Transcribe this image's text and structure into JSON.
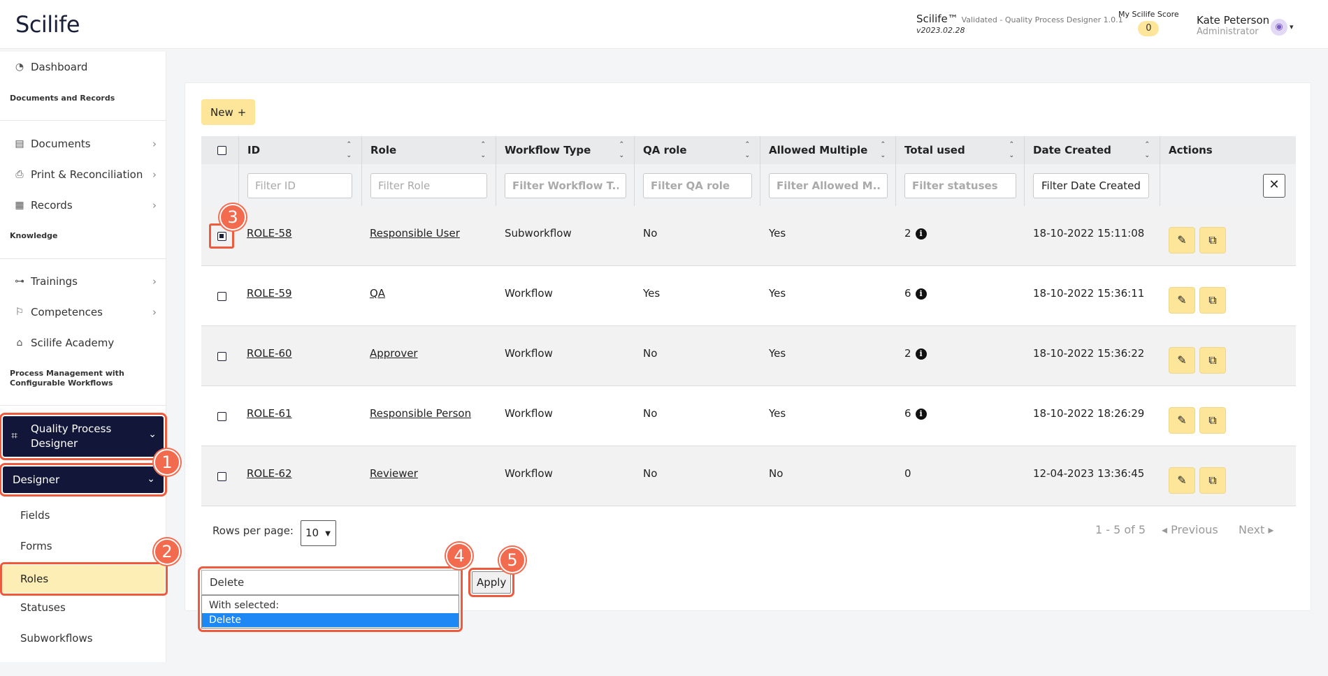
{
  "header": {
    "logo": "Scilife",
    "app_name": "Scilife™",
    "app_desc": "Validated - Quality Process Designer 1.0.1",
    "version": "v2023.02.28",
    "score_label": "My Scilife Score",
    "score_value": "0",
    "user_name": "Kate Peterson",
    "user_role": "Administrator"
  },
  "sidebar": {
    "dashboard": "Dashboard",
    "section_docs": "Documents and Records",
    "documents": "Documents",
    "print": "Print & Reconciliation",
    "records": "Records",
    "section_knowledge": "Knowledge",
    "trainings": "Trainings",
    "competences": "Competences",
    "academy": "Scilife Academy",
    "section_process": "Process Management with Configurable Workflows",
    "qpd": "Quality Process Designer",
    "designer": "Designer",
    "fields": "Fields",
    "forms": "Forms",
    "roles": "Roles",
    "statuses": "Statuses",
    "subworkflows": "Subworkflows"
  },
  "toolbar": {
    "new_label": "New"
  },
  "table": {
    "columns": [
      "ID",
      "Role",
      "Workflow Type",
      "QA role",
      "Allowed Multiple",
      "Total used",
      "Date Created",
      "Actions"
    ],
    "filters": {
      "id": "Filter ID",
      "role": "Filter Role",
      "workflow_type": "Filter Workflow T...",
      "qa_role": "Filter QA role",
      "allowed_multiple": "Filter Allowed M...",
      "total_used": "Filter statuses",
      "date_created": "Filter Date Created"
    },
    "rows": [
      {
        "id": "ROLE-58",
        "role": "Responsible User",
        "type": "Subworkflow",
        "qa": "No",
        "multiple": "Yes",
        "used": "2",
        "date": "18-10-2022 15:11:08",
        "checked": true
      },
      {
        "id": "ROLE-59",
        "role": "QA",
        "type": "Workflow",
        "qa": "Yes",
        "multiple": "Yes",
        "used": "6",
        "date": "18-10-2022 15:36:11",
        "checked": false
      },
      {
        "id": "ROLE-60",
        "role": "Approver",
        "type": "Workflow",
        "qa": "No",
        "multiple": "Yes",
        "used": "2",
        "date": "18-10-2022 15:36:22",
        "checked": false
      },
      {
        "id": "ROLE-61",
        "role": "Responsible Person",
        "type": "Workflow",
        "qa": "No",
        "multiple": "Yes",
        "used": "6",
        "date": "18-10-2022 18:26:29",
        "checked": false
      },
      {
        "id": "ROLE-62",
        "role": "Reviewer",
        "type": "Workflow",
        "qa": "No",
        "multiple": "No",
        "used": "0",
        "date": "12-04-2023 13:36:45",
        "checked": false
      }
    ]
  },
  "pagination": {
    "rows_per_page_label": "Rows per page:",
    "rows_per_page": "10",
    "count": "1 - 5 of 5",
    "previous": "Previous",
    "next": "Next"
  },
  "bulk": {
    "selected_value": "Delete",
    "options_header": "With selected:",
    "option_delete": "Delete",
    "apply_label": "Apply"
  },
  "steps": [
    "1",
    "2",
    "3",
    "4",
    "5"
  ],
  "colors": {
    "accent": "#fde59a",
    "nav_dark": "#12173a",
    "highlight": "#f05a3c",
    "select_blue": "#1e88f5"
  }
}
